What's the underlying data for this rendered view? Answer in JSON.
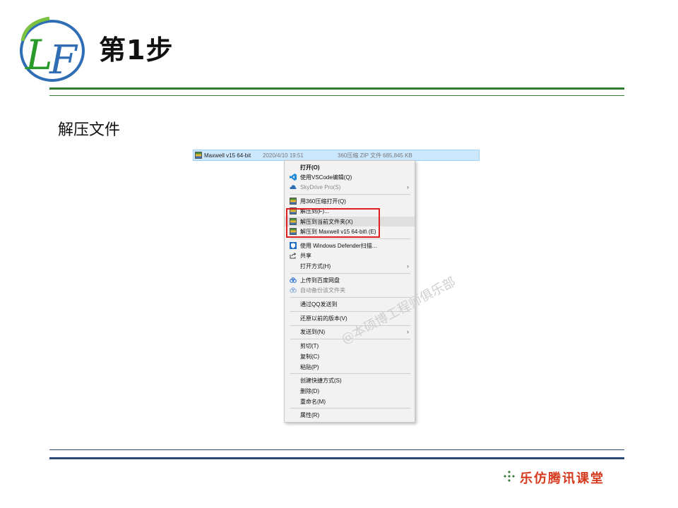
{
  "slide": {
    "title": "第1步",
    "subtitle": "解压文件",
    "logo_icon": "lf-logo-icon",
    "watermark": "@本硕博工程师俱乐部",
    "brand": "乐仿腾讯课堂",
    "brand_icon": "diamond-cluster-icon"
  },
  "file_row": {
    "name": "Maxwell v15 64-bit",
    "date": "2020/4/10 19:51",
    "type": "360压缩 ZIP 文件",
    "size": "685,845 KB"
  },
  "menu": {
    "items": [
      {
        "label": "打开(O)",
        "icon": "",
        "bold": true
      },
      {
        "label": "使用VSCode编辑(Q)",
        "icon": "vscode-icon"
      },
      {
        "label": "SkyDrive Pro(S)",
        "icon": "cloud-icon",
        "disabled": true,
        "submenu": true
      },
      {
        "label": "用360压缩打开(Q)",
        "icon": "archive-icon"
      },
      {
        "label": "解压到(F)...",
        "icon": "archive-icon"
      },
      {
        "label": "解压到当前文件夹(X)",
        "icon": "archive-icon"
      },
      {
        "label": "解压到 Maxwell v15 64-bit\\ (E)",
        "icon": "archive-icon"
      },
      {
        "label": "使用 Windows Defender扫描...",
        "icon": "defender-shield-icon"
      },
      {
        "label": "共享",
        "icon": "share-icon"
      },
      {
        "label": "打开方式(H)",
        "icon": "",
        "submenu": true
      },
      {
        "label": "上传到百度网盘",
        "icon": "baidu-cloud-icon"
      },
      {
        "label": "自动备份该文件夹",
        "icon": "baidu-cloud-icon",
        "disabled": true
      },
      {
        "label": "通过QQ发送到",
        "icon": ""
      },
      {
        "label": "还原以前的版本(V)",
        "icon": ""
      },
      {
        "label": "发送到(N)",
        "icon": "",
        "submenu": true
      },
      {
        "label": "剪切(T)",
        "icon": ""
      },
      {
        "label": "复制(C)",
        "icon": ""
      },
      {
        "label": "粘贴(P)",
        "icon": ""
      },
      {
        "label": "创建快捷方式(S)",
        "icon": ""
      },
      {
        "label": "删除(D)",
        "icon": ""
      },
      {
        "label": "重命名(M)",
        "icon": ""
      },
      {
        "label": "属性(R)",
        "icon": ""
      }
    ]
  },
  "colors": {
    "green_rule": "#2e7d32",
    "blue_rule": "#2b4a7a",
    "highlight_box": "#e02020",
    "brand_text": "#d63a1e",
    "selection": "#cce8ff"
  }
}
